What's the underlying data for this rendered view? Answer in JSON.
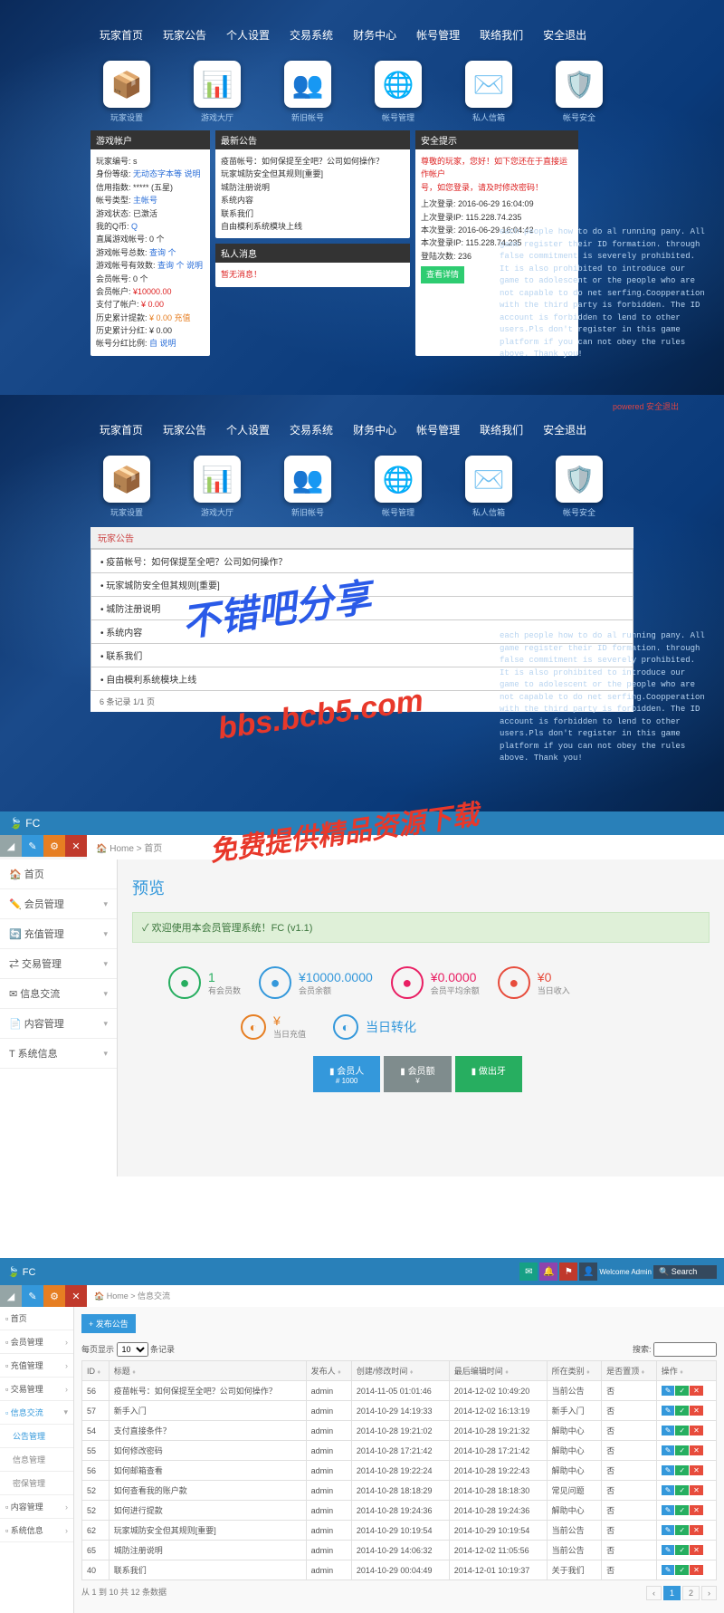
{
  "nav": [
    "玩家首页",
    "玩家公告",
    "个人设置",
    "交易系统",
    "财务中心",
    "帐号管理",
    "联络我们",
    "安全退出"
  ],
  "iconTiles": [
    {
      "label": "玩家设置",
      "emoji": "📦",
      "color": "#e67e22"
    },
    {
      "label": "游戏大厅",
      "emoji": "📊",
      "color": "#3498db"
    },
    {
      "label": "新旧帐号",
      "emoji": "👥",
      "color": "#27ae60"
    },
    {
      "label": "帐号管理",
      "emoji": "🌐",
      "color": "#2980b9"
    },
    {
      "label": "私人信箱",
      "emoji": "✉️",
      "color": "#95a5a6"
    },
    {
      "label": "帐号安全",
      "emoji": "🛡️",
      "color": "#27ae60"
    }
  ],
  "panel1": {
    "title": "游戏帐户",
    "rows": [
      {
        "k": "玩家编号:",
        "v": "s"
      },
      {
        "k": "身份等级:",
        "v": "无动态字本等 说明",
        "cls": "blue"
      },
      {
        "k": "信用指数:",
        "v": "***** (五星)"
      },
      {
        "k": "帐号类型:",
        "v": "主帐号",
        "cls": "blue"
      },
      {
        "k": "游戏状态:",
        "v": "已激活"
      },
      {
        "k": "我的Q币:",
        "v": "Q",
        "cls": "blue"
      },
      {
        "k": "直属游戏帐号:",
        "v": "0 个"
      },
      {
        "k": "游戏帐号总数:",
        "v": "查询 个",
        "cls": "blue"
      },
      {
        "k": "游戏帐号有效数:",
        "v": "查询 个 说明",
        "cls": "blue"
      },
      {
        "k": "会员帐号:",
        "v": "0 个"
      },
      {
        "k": "会员帐户:",
        "v": "¥10000.00",
        "cls": "red"
      },
      {
        "k": "支付了帐户:",
        "v": "¥ 0.00",
        "cls": "red"
      },
      {
        "k": "历史累计提款:",
        "v": "¥ 0.00 充值",
        "cls": "orange"
      },
      {
        "k": "历史累计分红:",
        "v": "¥ 0.00"
      },
      {
        "k": "帐号分红比例:",
        "v": "自 说明",
        "cls": "blue"
      }
    ]
  },
  "panel2": {
    "title": "最新公告",
    "rows": [
      "疫苗帐号：如何保提至全吧？公司如何操作？",
      "玩家城防安全但其规则[重要]",
      "城防注册说明",
      "系统内容",
      "联系我们",
      "自由模利系统模块上线"
    ],
    "title2": "私人消息",
    "msg": "暂无消息！"
  },
  "panel3": {
    "title": "安全提示",
    "warn1": "尊敬的玩家，您好！如下您还在于直接运作帐户",
    "warn2": "号，如您登录，请及时修改密码！",
    "rows": [
      {
        "k": "上次登录:",
        "v": "2016-06-29 16:04:09"
      },
      {
        "k": "上次登录IP:",
        "v": "115.228.74.235"
      },
      {
        "k": "本次登录:",
        "v": "2016-06-29 16:04:42"
      },
      {
        "k": "本次登录IP:",
        "v": "115.228.74.235"
      },
      {
        "k": "登陆次数:",
        "v": "236"
      }
    ],
    "btn": "查看详情"
  },
  "sideText": "each people how to do al running pany. All game register their ID formation. through false commitment is severely prohibited. It is also prohibited to introduce our game to adolescent or the people who are not capable to do net serfing.Coopperation with the third party is forbidden. The ID account is forbidden to lend to other users.Pls don't register in this game platform if you can not obey the rules above. Thank you!",
  "topbar2": "powered 安全退出",
  "announceTab": "玩家公告",
  "announceRows": [
    "疫苗帐号：如何保提至全吧？公司如何操作？",
    "玩家城防安全但其规则[重要]",
    "城防注册说明",
    "系统内容",
    "联系我们",
    "自由模利系统模块上线"
  ],
  "announceFoot": "6 条记录 1/1 页",
  "watermarks": {
    "blue": "不错吧分享",
    "red1": "bbs.bcb5.com",
    "red2": "免费提供精品资源下载"
  },
  "admin": {
    "brand": "FC",
    "crumb": "Home > 首页",
    "title": "预览",
    "alert": "✓ 欢迎使用本会员管理系统！FC (v1.1)",
    "side": [
      {
        "icon": "🏠",
        "label": "首页"
      },
      {
        "icon": "✏️",
        "label": "会员管理",
        "chev": "▾"
      },
      {
        "icon": "🔄",
        "label": "充值管理",
        "chev": "▾"
      },
      {
        "icon": "⇄",
        "label": "交易管理",
        "chev": "▾"
      },
      {
        "icon": "✉",
        "label": "信息交流",
        "chev": "▾"
      },
      {
        "icon": "📄",
        "label": "内容管理",
        "chev": "▾"
      },
      {
        "icon": "T",
        "label": "系统信息",
        "chev": "▾"
      }
    ],
    "stats": [
      {
        "color": "#27ae60",
        "val": "1",
        "lbl": "有会员数"
      },
      {
        "color": "#3498db",
        "val": "¥10000.0000",
        "lbl": "会员余额"
      },
      {
        "color": "#e91e63",
        "val": "¥0.0000",
        "lbl": "会员平均余额"
      },
      {
        "color": "#e74c3c",
        "val": "¥0",
        "lbl": "当日收入"
      }
    ],
    "stats2": [
      {
        "color": "#e67e22",
        "val": "¥",
        "lbl": "当日充值"
      },
      {
        "color": "#3498db",
        "val": "当日转化",
        "lbl": ""
      }
    ],
    "btns": [
      {
        "cls": "b-blue",
        "t": "会员人",
        "s": "# 1000"
      },
      {
        "cls": "b-gray",
        "t": "会员额",
        "s": "¥"
      },
      {
        "cls": "b-green",
        "t": "做出牙",
        "s": ""
      }
    ]
  },
  "admin2": {
    "brand": "FC",
    "crumb": "Home > 信息交流",
    "welcome": "Welcome Admin",
    "searchPh": "Search",
    "addBtn": "+ 发布公告",
    "side": [
      {
        "label": "首页"
      },
      {
        "label": "会员管理",
        "chev": "›"
      },
      {
        "label": "充值管理",
        "chev": "›"
      },
      {
        "label": "交易管理",
        "chev": "›"
      },
      {
        "label": "信息交流",
        "chev": "▾",
        "active": true
      },
      {
        "label": "公告管理",
        "sub": true,
        "active": true
      },
      {
        "label": "信息管理",
        "sub": true
      },
      {
        "label": "密保管理",
        "sub": true
      },
      {
        "label": "内容管理",
        "chev": "›"
      },
      {
        "label": "系统信息",
        "chev": "›"
      }
    ],
    "perPageLabel": "每页显示",
    "perPage": "10",
    "perPageSuffix": "条记录",
    "searchLabel": "搜索:",
    "headers": [
      "ID",
      "标题",
      "发布人",
      "创建/修改时间",
      "最后编辑时间",
      "所在类别",
      "是否置顶",
      "操作"
    ],
    "rows": [
      {
        "id": "56",
        "title": "疫苗帐号：如何保提至全吧？公司如何操作？",
        "user": "admin",
        "t1": "2014-11-05 01:01:46",
        "t2": "2014-12-02 10:49:20",
        "cat": "当前公告",
        "top": "否"
      },
      {
        "id": "57",
        "title": "新手入门",
        "user": "admin",
        "t1": "2014-10-29 14:19:33",
        "t2": "2014-12-02 16:13:19",
        "cat": "新手入门",
        "top": "否"
      },
      {
        "id": "54",
        "title": "支付直接条件？",
        "user": "admin",
        "t1": "2014-10-28 19:21:02",
        "t2": "2014-10-28 19:21:32",
        "cat": "解助中心",
        "top": "否"
      },
      {
        "id": "55",
        "title": "如何修改密码",
        "user": "admin",
        "t1": "2014-10-28 17:21:42",
        "t2": "2014-10-28 17:21:42",
        "cat": "解助中心",
        "top": "否"
      },
      {
        "id": "56",
        "title": "如何邮箱查看",
        "user": "admin",
        "t1": "2014-10-28 19:22:24",
        "t2": "2014-10-28 19:22:43",
        "cat": "解助中心",
        "top": "否"
      },
      {
        "id": "52",
        "title": "如何查看我的账户款",
        "user": "admin",
        "t1": "2014-10-28 18:18:29",
        "t2": "2014-10-28 18:18:30",
        "cat": "常见问题",
        "top": "否"
      },
      {
        "id": "52",
        "title": "如何进行提款",
        "user": "admin",
        "t1": "2014-10-28 19:24:36",
        "t2": "2014-10-28 19:24:36",
        "cat": "解助中心",
        "top": "否"
      },
      {
        "id": "62",
        "title": "玩家城防安全但其规则[重要]",
        "user": "admin",
        "t1": "2014-10-29 10:19:54",
        "t2": "2014-10-29 10:19:54",
        "cat": "当前公告",
        "top": "否"
      },
      {
        "id": "65",
        "title": "城防注册说明",
        "user": "admin",
        "t1": "2014-10-29 14:06:32",
        "t2": "2014-12-02 11:05:56",
        "cat": "当前公告",
        "top": "否"
      },
      {
        "id": "40",
        "title": "联系我们",
        "user": "admin",
        "t1": "2014-10-29 00:04:49",
        "t2": "2014-12-01 10:19:37",
        "cat": "关于我们",
        "top": "否"
      }
    ],
    "footL": "从 1 到 10 共 12 条数据",
    "pages": [
      "‹",
      "1",
      "2",
      "›"
    ]
  }
}
